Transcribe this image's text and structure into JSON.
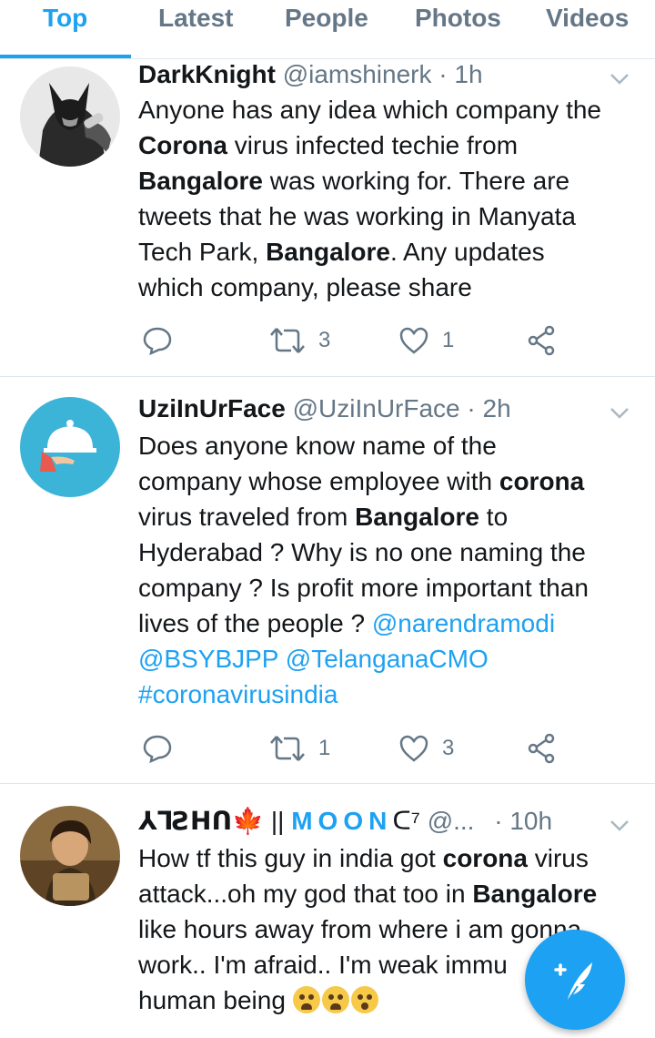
{
  "tabs": [
    {
      "label": "Top",
      "active": true
    },
    {
      "label": "Latest",
      "active": false
    },
    {
      "label": "People",
      "active": false
    },
    {
      "label": "Photos",
      "active": false
    },
    {
      "label": "Videos",
      "active": false
    }
  ],
  "tweets": [
    {
      "name": "DarkKnight",
      "handle": "@iamshinerk",
      "time": "· 1h",
      "lines": [
        "Anyone has any idea which company the",
        "virus infected techie from",
        "was working for. There are",
        "tweets that he was working in Manyata",
        "Tech Park,",
        ". Any updates",
        "which company, please share"
      ],
      "bold": [
        "Corona",
        "Bangalore"
      ],
      "retweets": "3",
      "likes": "1"
    },
    {
      "name": "UziInUrFace",
      "handle": "@UziInUrFace",
      "time": "· 2h",
      "lines": [
        "Does anyone know name of the",
        "company whose  employee with",
        "virus traveled from",
        "to",
        "Hyderabad ? Why is no one naming the",
        "company ? Is profit more important than",
        "lives of the people ?"
      ],
      "bold": [
        "corona",
        "Bangalore"
      ],
      "mentions": [
        "@narendramodi",
        "@BSYBJPP",
        "@TelanganaCMO",
        "#coronavirusindia"
      ],
      "retweets": "1",
      "likes": "3"
    },
    {
      "name": "⅄ꓶꙄꓧꓵ",
      "name_extra": "||",
      "moon": "MOON",
      "name_tail": "ᑕ⁷",
      "handle": "@...",
      "time": "· 10h",
      "lines": [
        "How tf this guy in india got",
        "virus",
        "attack...oh my god that too in",
        "like hours away from where i am gonna",
        "work.. I'm afraid.. I'm weak immu",
        "human being"
      ],
      "bold": [
        "corona",
        "Bangalore"
      ]
    }
  ],
  "icons": [
    "reply-icon",
    "retweet-icon",
    "like-icon",
    "share-icon",
    "chevron-down-icon",
    "compose-icon"
  ],
  "colors": {
    "accent": "#1da1f2",
    "muted": "#657786",
    "text": "#14171a",
    "divider": "#e1e8ed"
  }
}
